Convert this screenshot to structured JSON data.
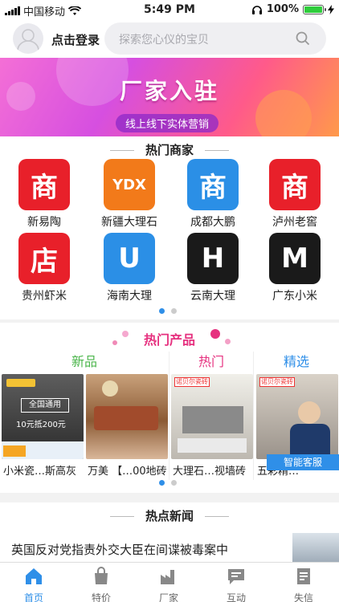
{
  "status": {
    "carrier": "中国移动",
    "time": "5:49 PM",
    "battery": "100%"
  },
  "header": {
    "login": "点击登录",
    "search_placeholder": "探索您心仪的宝贝"
  },
  "banner": {
    "title": "厂家入驻",
    "subtitle": "线上线下实体营销"
  },
  "merchants": {
    "title": "热门商家",
    "items": [
      {
        "label": "新易陶",
        "logo": "商",
        "color": "#e8202a"
      },
      {
        "label": "新疆大理石",
        "logo": "YDX",
        "color": "#f27a1a"
      },
      {
        "label": "成都大鹏",
        "logo": "商",
        "color": "#2b8fe6"
      },
      {
        "label": "泸州老窖",
        "logo": "商",
        "color": "#e8202a"
      },
      {
        "label": "贵州虾米",
        "logo": "店",
        "color": "#e8202a"
      },
      {
        "label": "海南大理",
        "logo": "U",
        "color": "#2b8fe6"
      },
      {
        "label": "云南大理",
        "logo": "H",
        "color": "#1a1a1a"
      },
      {
        "label": "广东小米",
        "logo": "M",
        "color": "#1a1a1a"
      }
    ],
    "pager": {
      "pages": 2,
      "active": 0
    }
  },
  "products": {
    "title": "热门产品",
    "columns": [
      {
        "label": "新品",
        "color": "#4cb64c"
      },
      {
        "label": "热门",
        "color": "#e6317f"
      },
      {
        "label": "精选",
        "color": "#2f8fe8"
      }
    ],
    "cards": [
      {
        "caption": "小米瓷…斯高灰",
        "overlay": "全国通用",
        "overlay2": "10元抵200元"
      },
      {
        "caption": "万美 【…00地砖",
        "overlay": "",
        "overlay2": ""
      },
      {
        "caption": "大理石…视墙砖",
        "overlay": "诺贝尔瓷砖",
        "overlay2": ""
      },
      {
        "caption": "五彩精…",
        "overlay": "诺贝尔瓷砖",
        "overlay2": ""
      }
    ],
    "service": "智能客服",
    "pager": {
      "pages": 2,
      "active": 0
    }
  },
  "news": {
    "title": "热点新闻",
    "headline": "英国反对党指责外交大臣在间谍被毒案中"
  },
  "tabbar": [
    {
      "label": "首页",
      "icon": "home-icon",
      "active": true
    },
    {
      "label": "特价",
      "icon": "bag-icon",
      "active": false
    },
    {
      "label": "厂家",
      "icon": "factory-icon",
      "active": false
    },
    {
      "label": "互动",
      "icon": "chat-icon",
      "active": false
    },
    {
      "label": "失信",
      "icon": "document-icon",
      "active": false
    }
  ]
}
